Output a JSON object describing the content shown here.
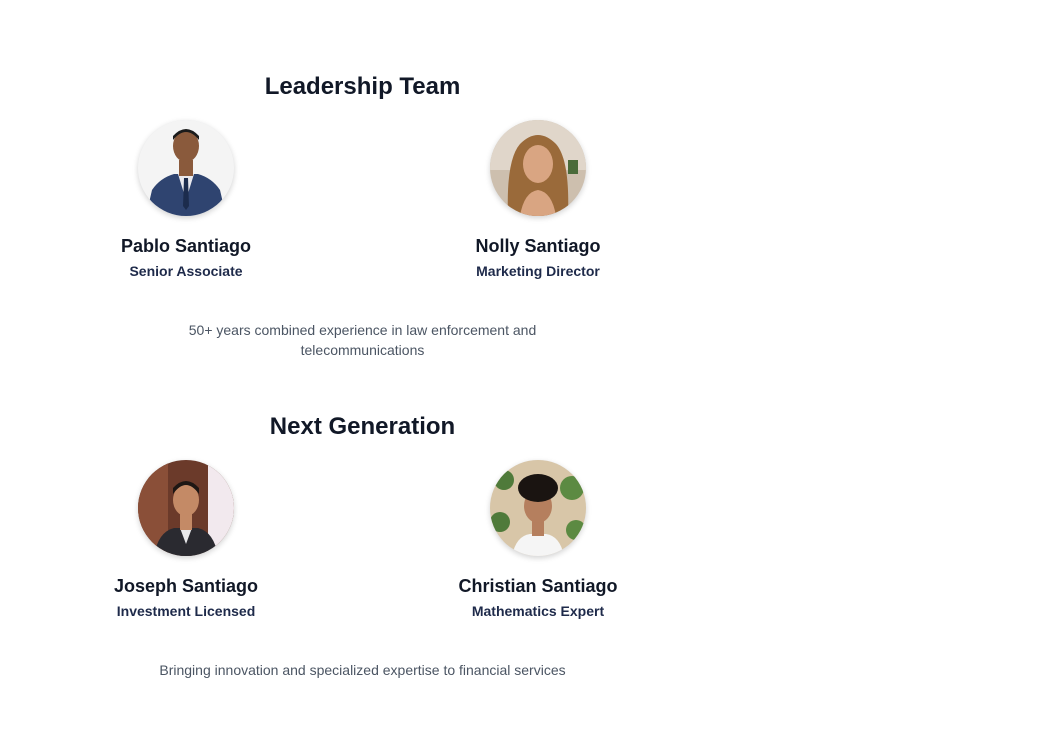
{
  "sections": {
    "leadership": {
      "title": "Leadership Team",
      "caption": "50+ years combined experience in law enforcement and telecommunications",
      "members": [
        {
          "name": "Pablo Santiago",
          "role": "Senior Associate"
        },
        {
          "name": "Nolly Santiago",
          "role": "Marketing Director"
        }
      ]
    },
    "next_generation": {
      "title": "Next Generation",
      "caption": "Bringing innovation and specialized expertise to financial services",
      "members": [
        {
          "name": "Joseph Santiago",
          "role": "Investment Licensed"
        },
        {
          "name": "Christian Santiago",
          "role": "Mathematics Expert"
        }
      ]
    }
  },
  "colors": {
    "heading": "#111827",
    "role": "#1e2a4a",
    "caption": "#4b5563",
    "background": "#ffffff"
  },
  "icons": {
    "avatar": "portrait-photo"
  }
}
